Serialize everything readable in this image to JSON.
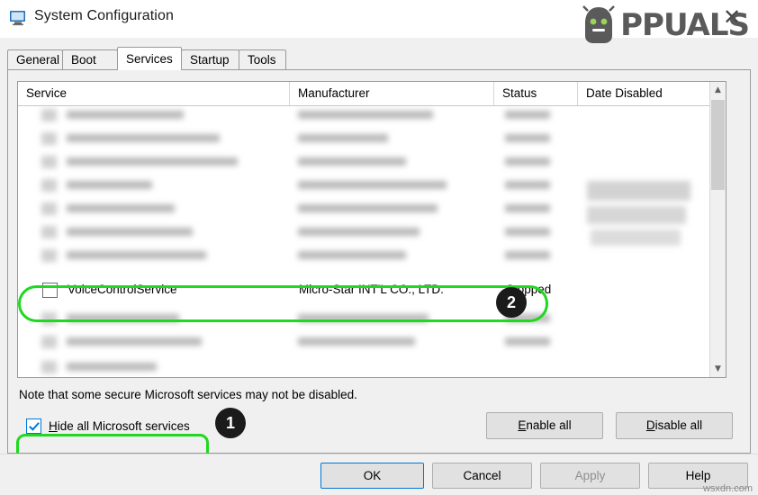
{
  "window": {
    "title": "System Configuration",
    "icon": "system-configuration-icon",
    "close_label": "✕"
  },
  "watermark": {
    "text": "PPUALS",
    "full_text": "APPUALS"
  },
  "tabs": [
    {
      "label": "General",
      "active": false
    },
    {
      "label": "Boot",
      "active": false
    },
    {
      "label": "Services",
      "active": true
    },
    {
      "label": "Startup",
      "active": false
    },
    {
      "label": "Tools",
      "active": false
    }
  ],
  "services_table": {
    "columns": [
      "Service",
      "Manufacturer",
      "Status",
      "Date Disabled"
    ],
    "highlighted_row": {
      "checked": false,
      "service": "VoiceControlService",
      "manufacturer": "Micro-Star INT'L CO., LTD.",
      "status": "Stopped"
    },
    "scrollbar": {
      "up_arrow": "▲",
      "down_arrow": "▼"
    }
  },
  "callouts": [
    {
      "id": "1",
      "target": "hide-all-microsoft-services-checkbox"
    },
    {
      "id": "2",
      "target": "voicecontrolservice-row"
    }
  ],
  "note": "Note that some secure Microsoft services may not be disabled.",
  "hide_all": {
    "label_underlined": "H",
    "label_rest": "ide all Microsoft services",
    "checked": true
  },
  "buttons": {
    "enable_all": {
      "underlined": "E",
      "rest": "nable all"
    },
    "disable_all": {
      "underlined": "D",
      "rest": "isable all"
    },
    "ok": "OK",
    "cancel": "Cancel",
    "apply": "Apply",
    "apply_enabled": false,
    "help": "Help"
  },
  "footer_credit": "wsxdn.com"
}
